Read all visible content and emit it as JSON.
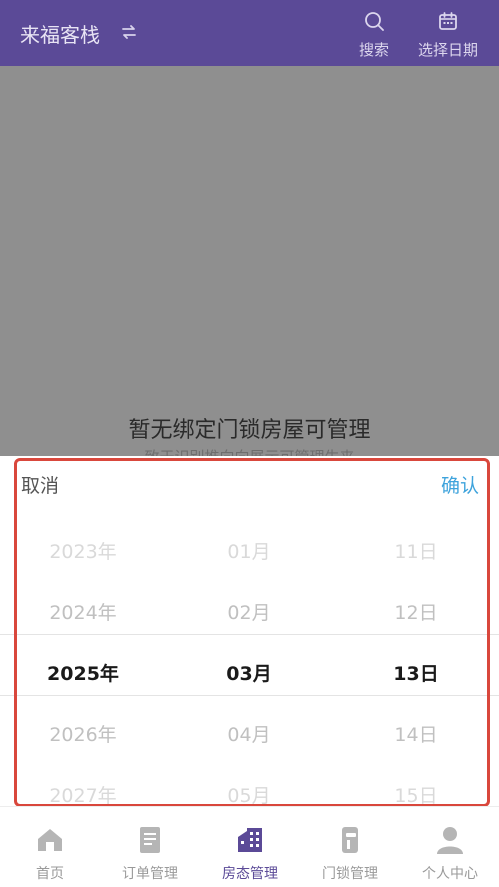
{
  "header": {
    "title": "来福客栈",
    "switch_icon": "swap-icon",
    "actions": [
      {
        "label": "搜索",
        "icon": "search-icon"
      },
      {
        "label": "选择日期",
        "icon": "calendar-icon"
      }
    ]
  },
  "content": {
    "empty_text": "暂无绑定门锁房屋可管理",
    "empty_sub": "致于识别推向向展示可管理生来"
  },
  "picker": {
    "cancel_label": "取消",
    "confirm_label": "确认",
    "years": [
      "2023年",
      "2024年",
      "2025年",
      "2026年",
      "2027年"
    ],
    "months": [
      "01月",
      "02月",
      "03月",
      "04月",
      "05月"
    ],
    "days": [
      "11日",
      "12日",
      "13日",
      "14日",
      "15日"
    ],
    "selected": {
      "year": "2025年",
      "month": "03月",
      "day": "13日"
    }
  },
  "tabs": [
    {
      "label": "首页",
      "icon": "home-icon",
      "active": false
    },
    {
      "label": "订单管理",
      "icon": "order-icon",
      "active": false
    },
    {
      "label": "房态管理",
      "icon": "building-icon",
      "active": true
    },
    {
      "label": "门锁管理",
      "icon": "door-lock-icon",
      "active": false
    },
    {
      "label": "个人中心",
      "icon": "user-icon",
      "active": false
    }
  ],
  "colors": {
    "brand": "#5b4a97",
    "confirm": "#3ea3dc",
    "overlay": "#8f8f8f",
    "highlight": "#d9473c"
  }
}
